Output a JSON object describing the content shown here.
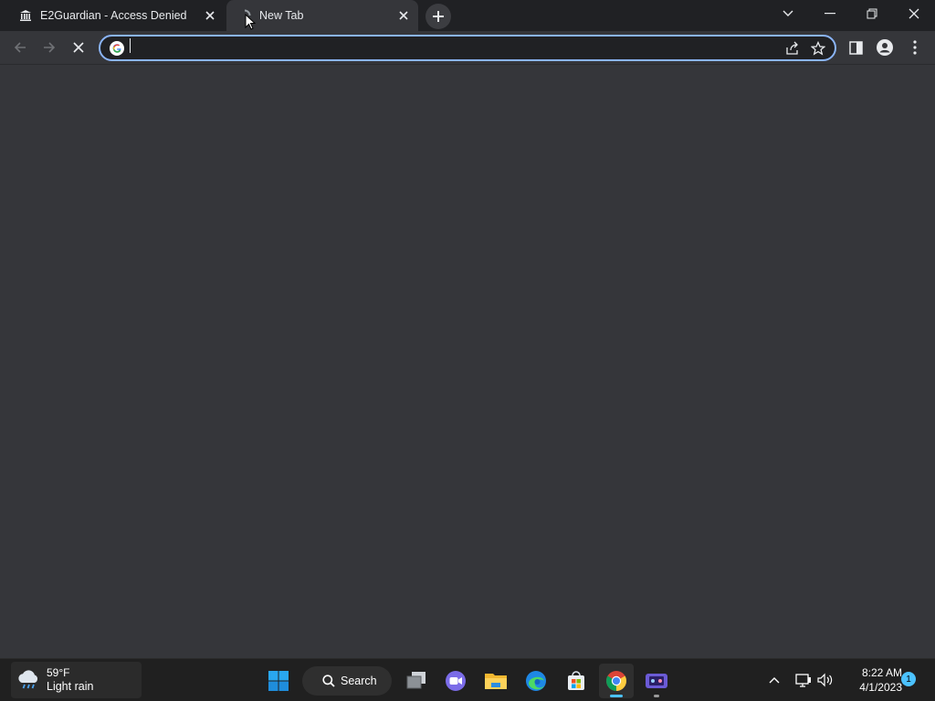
{
  "browser": {
    "tabs": [
      {
        "title": "E2Guardian - Access Denied",
        "favicon": "institution-icon",
        "active": false
      },
      {
        "title": "New Tab",
        "favicon": "loading-spinner-icon",
        "active": true
      }
    ],
    "omnibox": {
      "value": "",
      "placeholder": ""
    },
    "colors": {
      "frame": "#202124",
      "toolbar": "#35363a",
      "focus_ring": "#8ab4f8",
      "text": "#e8eaed"
    }
  },
  "taskbar": {
    "weather": {
      "temp": "59°F",
      "condition": "Light rain"
    },
    "search_label": "Search",
    "pinned": [
      "start-icon",
      "task-view-icon",
      "chat-icon",
      "file-explorer-icon",
      "edge-icon",
      "store-icon",
      "chrome-icon",
      "game-icon"
    ],
    "clock": {
      "time": "8:22 AM",
      "date": "4/1/2023"
    },
    "notification_count": "1"
  }
}
